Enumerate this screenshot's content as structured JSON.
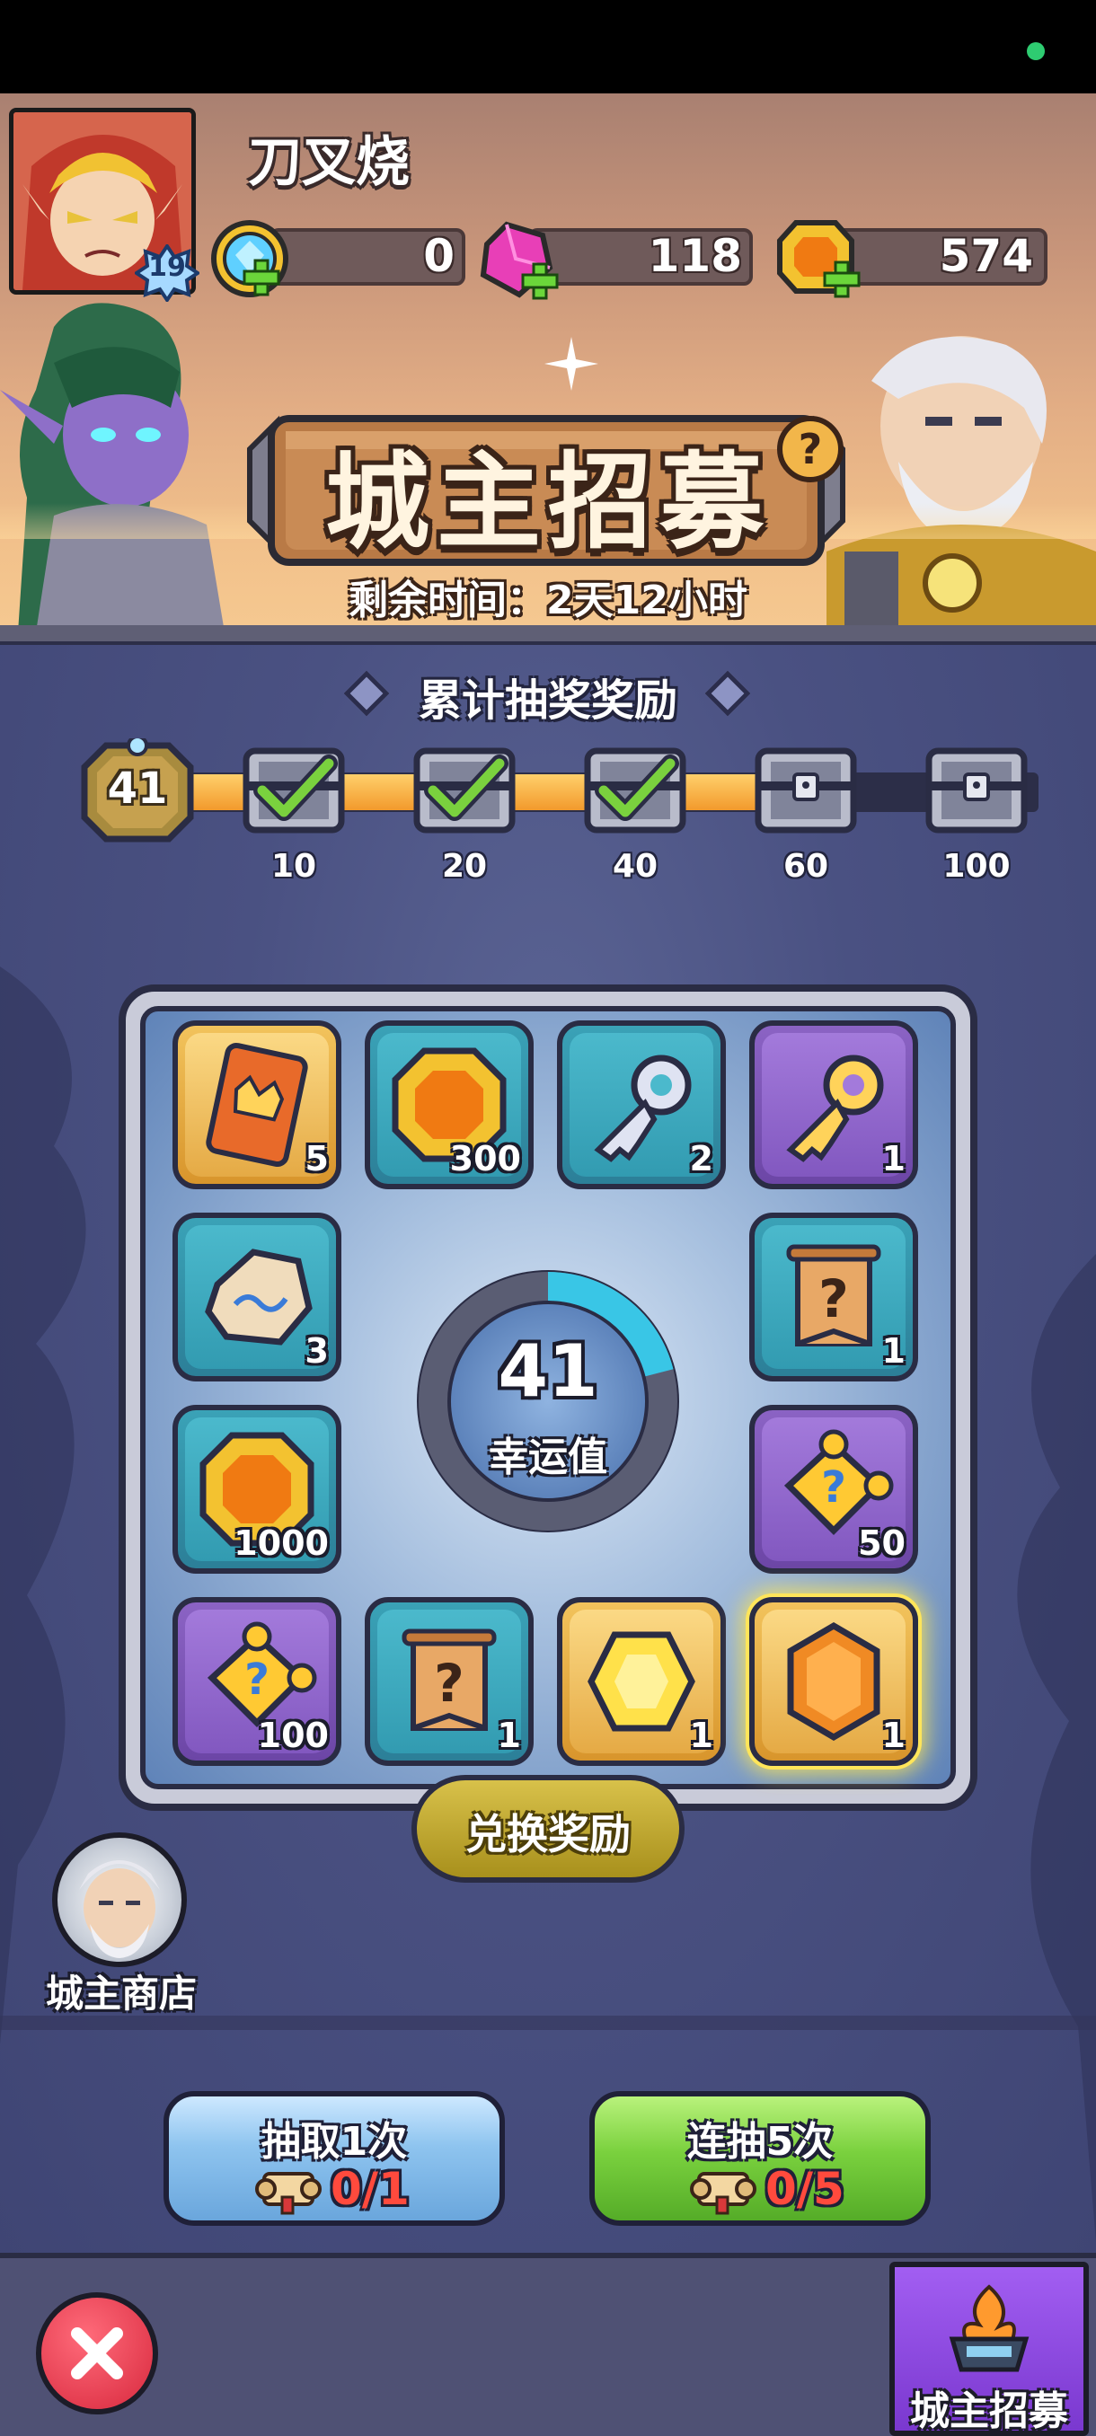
{
  "player": {
    "name": "刀叉烧",
    "level": "19"
  },
  "resources": [
    {
      "name": "diamond-coin",
      "value": "0"
    },
    {
      "name": "gem",
      "value": "118"
    },
    {
      "name": "gold-coin",
      "value": "574"
    }
  ],
  "event": {
    "title": "城主招募",
    "time_remaining": "剩余时间：2天12小时"
  },
  "cumulative_rewards": {
    "title": "累计抽奖奖励",
    "current_count": "41",
    "progress_fraction": 0.74,
    "milestones": [
      {
        "label": "10",
        "claimed": true
      },
      {
        "label": "20",
        "claimed": true
      },
      {
        "label": "40",
        "claimed": true
      },
      {
        "label": "60",
        "claimed": false
      },
      {
        "label": "100",
        "claimed": false
      }
    ]
  },
  "prize_pool": {
    "items": [
      {
        "icon": "recruit-card-icon",
        "count": "5",
        "rarity": "gold"
      },
      {
        "icon": "gold-coin-icon",
        "count": "300",
        "rarity": "teal"
      },
      {
        "icon": "silver-key-icon",
        "count": "2",
        "rarity": "teal"
      },
      {
        "icon": "gold-key-icon",
        "count": "1",
        "rarity": "purple"
      },
      {
        "icon": "rune-stone-icon",
        "count": "3",
        "rarity": "teal"
      },
      {
        "icon": "mystery-scroll-icon",
        "count": "1",
        "rarity": "teal"
      },
      {
        "icon": "gold-coin-icon",
        "count": "1000",
        "rarity": "teal"
      },
      {
        "icon": "mystery-puzzle-icon",
        "count": "50",
        "rarity": "purple"
      },
      {
        "icon": "mystery-puzzle-icon",
        "count": "100",
        "rarity": "purple"
      },
      {
        "icon": "mystery-scroll-icon",
        "count": "1",
        "rarity": "teal"
      },
      {
        "icon": "yellow-gem-icon",
        "count": "1",
        "rarity": "gold"
      },
      {
        "icon": "orange-gem-icon",
        "count": "1",
        "rarity": "gold"
      }
    ],
    "luck_value": "41",
    "luck_label": "幸运值",
    "luck_fraction": 0.21,
    "exchange_label": "兑换奖励"
  },
  "shop": {
    "label": "城主商店"
  },
  "draw": {
    "single": {
      "label": "抽取1次",
      "cost": "0/1"
    },
    "multi": {
      "label": "连抽5次",
      "cost": "0/5"
    }
  },
  "bottom_tab": {
    "label": "城主招募"
  },
  "colors": {
    "accent_orange": "#f29a2c",
    "check_green": "#7ad13e",
    "cost_red": "#ff4a3d",
    "luck_ring": "#39c6e6"
  }
}
